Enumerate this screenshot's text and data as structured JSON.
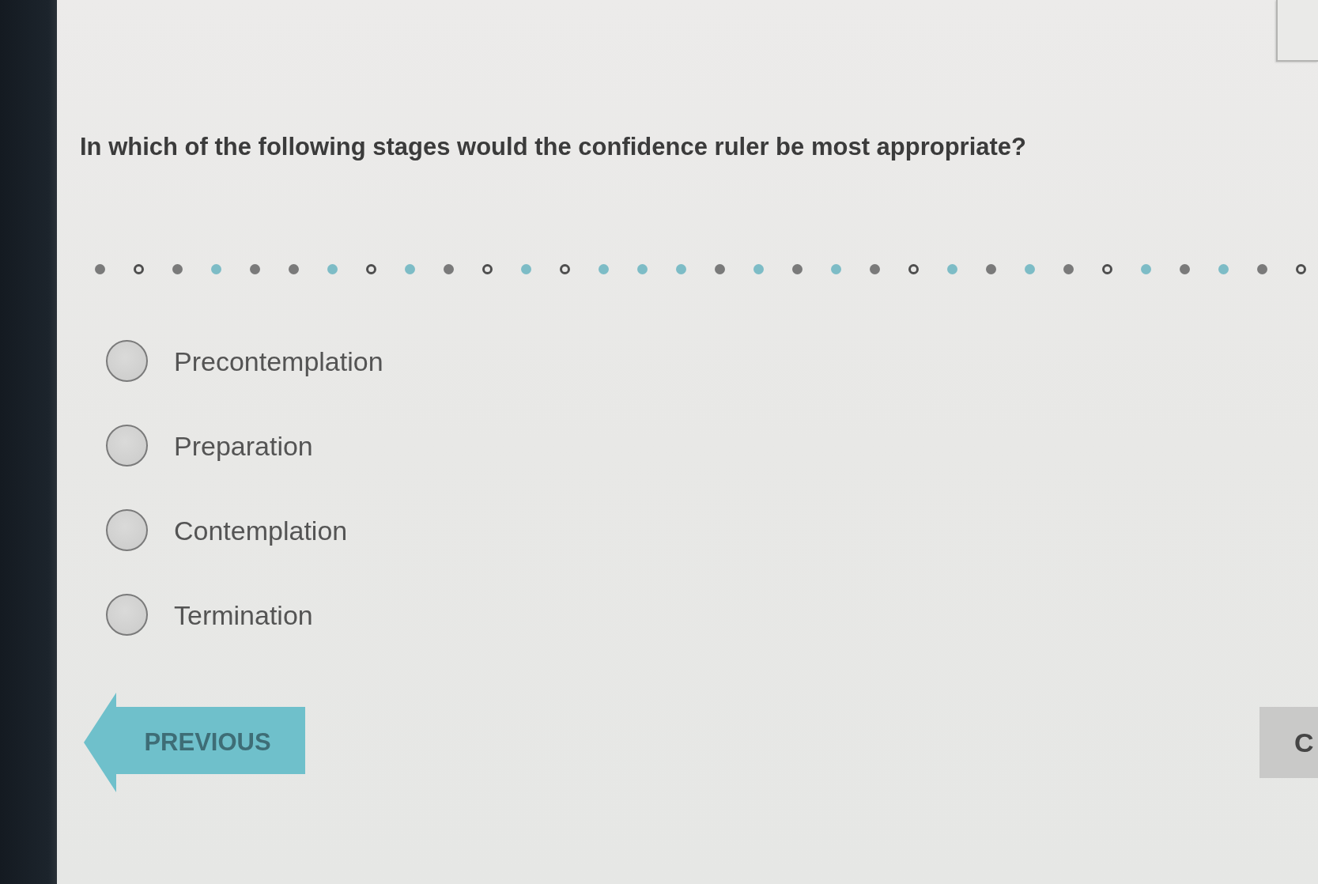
{
  "question": "In which of the following stages would the confidence ruler be most appropriate?",
  "divider": {
    "dots": [
      {
        "kind": "dot",
        "color": "#7a7a7a"
      },
      {
        "kind": "ring",
        "color": "#4e4e4e"
      },
      {
        "kind": "dot",
        "color": "#7a7a7a"
      },
      {
        "kind": "dot",
        "color": "#7dbcc6"
      },
      {
        "kind": "dot",
        "color": "#7a7a7a"
      },
      {
        "kind": "dot",
        "color": "#7a7a7a"
      },
      {
        "kind": "dot",
        "color": "#7dbcc6"
      },
      {
        "kind": "ring",
        "color": "#4e4e4e"
      },
      {
        "kind": "dot",
        "color": "#7dbcc6"
      },
      {
        "kind": "dot",
        "color": "#7a7a7a"
      },
      {
        "kind": "ring",
        "color": "#4e4e4e"
      },
      {
        "kind": "dot",
        "color": "#7dbcc6"
      },
      {
        "kind": "ring",
        "color": "#4e4e4e"
      },
      {
        "kind": "dot",
        "color": "#7dbcc6"
      },
      {
        "kind": "dot",
        "color": "#7dbcc6"
      },
      {
        "kind": "dot",
        "color": "#7dbcc6"
      },
      {
        "kind": "dot",
        "color": "#7a7a7a"
      },
      {
        "kind": "dot",
        "color": "#7dbcc6"
      },
      {
        "kind": "dot",
        "color": "#7a7a7a"
      },
      {
        "kind": "dot",
        "color": "#7dbcc6"
      },
      {
        "kind": "dot",
        "color": "#7a7a7a"
      },
      {
        "kind": "ring",
        "color": "#4e4e4e"
      },
      {
        "kind": "dot",
        "color": "#7dbcc6"
      },
      {
        "kind": "dot",
        "color": "#7a7a7a"
      },
      {
        "kind": "dot",
        "color": "#7dbcc6"
      },
      {
        "kind": "dot",
        "color": "#7a7a7a"
      },
      {
        "kind": "ring",
        "color": "#4e4e4e"
      },
      {
        "kind": "dot",
        "color": "#7dbcc6"
      },
      {
        "kind": "dot",
        "color": "#7a7a7a"
      },
      {
        "kind": "dot",
        "color": "#7dbcc6"
      },
      {
        "kind": "dot",
        "color": "#7a7a7a"
      },
      {
        "kind": "ring",
        "color": "#4e4e4e"
      }
    ]
  },
  "options": [
    {
      "label": "Precontemplation",
      "selected": false
    },
    {
      "label": "Preparation",
      "selected": false
    },
    {
      "label": "Contemplation",
      "selected": false
    },
    {
      "label": "Termination",
      "selected": false
    }
  ],
  "nav_buttons": [
    {
      "kind": "arrow",
      "label": "PREVIOUS"
    },
    {
      "kind": "block",
      "label": "C"
    }
  ]
}
